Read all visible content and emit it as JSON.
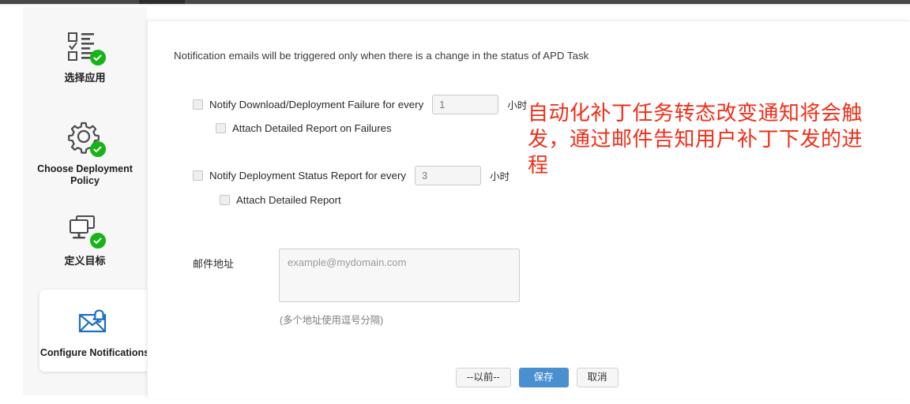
{
  "wizard": {
    "steps": [
      {
        "label": "选择应用",
        "icon": "checklist-icon",
        "completed": true,
        "active": false
      },
      {
        "label": "Choose Deployment Policy",
        "icon": "gear-icon",
        "completed": true,
        "active": false
      },
      {
        "label": "定义目标",
        "icon": "monitors-icon",
        "completed": true,
        "active": false
      },
      {
        "label": "Configure Notifications",
        "icon": "envelope-bell-icon",
        "completed": false,
        "active": true
      }
    ]
  },
  "form": {
    "intro": "Notification emails will be triggered only when there is a change in the status of APD Task",
    "failure_row": {
      "label": "Notify Download/Deployment Failure for every",
      "value": "1",
      "unit": "小时",
      "checked": false
    },
    "failure_sub": {
      "label": "Attach Detailed Report on Failures",
      "checked": false
    },
    "status_row": {
      "label": "Notify Deployment Status Report for every",
      "value": "3",
      "unit": "小时",
      "checked": false
    },
    "status_sub": {
      "label": "Attach Detailed Report",
      "checked": false
    },
    "email": {
      "label": "邮件地址",
      "value": "",
      "placeholder": "example@mydomain.com",
      "hint": "(多个地址使用逗号分隔)"
    }
  },
  "footer": {
    "previous_label": "--以前--",
    "save_label": "保存",
    "cancel_label": "取消"
  },
  "annotation": {
    "text": "自动化补丁任务转态改变通知将会触发，通过邮件告知用户补丁下发的进程",
    "color": "#f02e18"
  },
  "colors": {
    "accent": "#4a8fd0",
    "success": "#17b318",
    "annotation": "#f02e18",
    "panel": "#ffffff",
    "rail": "#f7f7f7"
  }
}
